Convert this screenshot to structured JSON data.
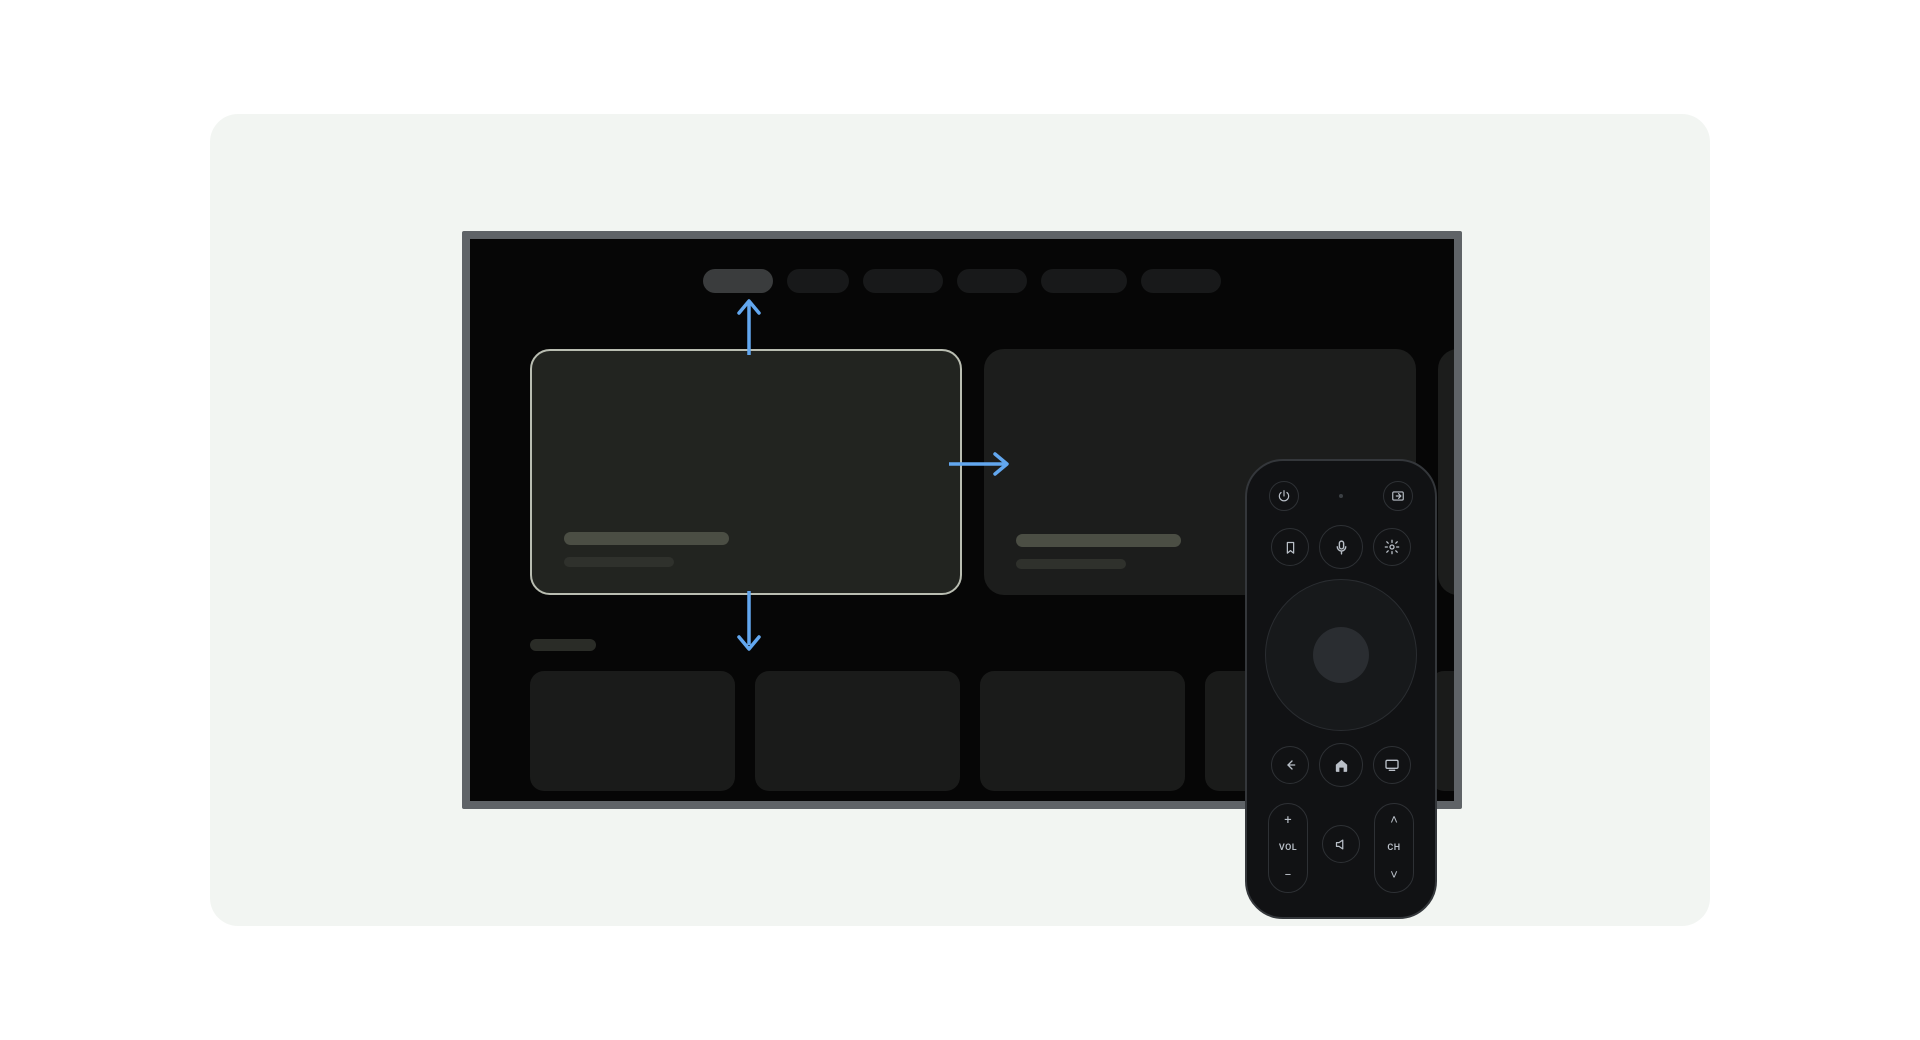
{
  "figure": {
    "description": "TV interface focus-navigation diagram with d-pad remote",
    "arrow_color": "#62a7ef"
  },
  "remote": {
    "vol_label": "VOL",
    "ch_label": "CH",
    "buttons": {
      "power": "power-icon",
      "input": "input-icon",
      "bookmark": "bookmark-icon",
      "mic": "mic-icon",
      "settings": "settings-icon",
      "back": "back-icon",
      "home": "home-icon",
      "guide": "guide-icon",
      "mute": "mute-icon"
    }
  }
}
